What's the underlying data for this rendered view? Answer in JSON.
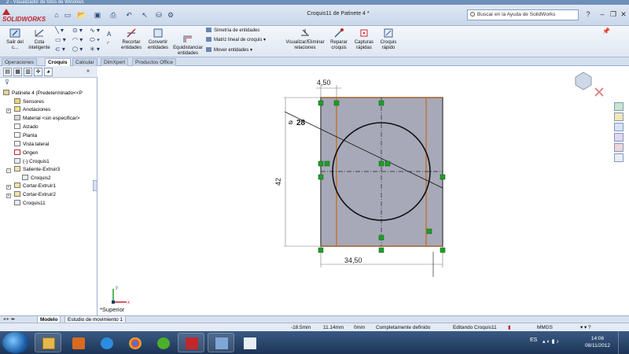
{
  "outer_window": {
    "title": "2 - Visualizador de fotos de Windows"
  },
  "titlebar": {
    "app_name": "SOLIDWORKS",
    "doc_title": "Croquis11 de Patinete 4 *",
    "help_search_placeholder": "Buscar en la Ayuda de SolidWorks"
  },
  "ribbon": {
    "exit_sketch": "Salir del c...",
    "smart_dim_1": "Cota",
    "smart_dim_2": "inteligente",
    "trim_1": "Recortar",
    "trim_2": "entidades",
    "convert_1": "Convertir",
    "convert_2": "entidades",
    "offset_1": "Equidistanciar",
    "offset_2": "entidades",
    "mirror": "Simetría de entidades",
    "linear_pattern": "Matriz lineal de croquis",
    "move": "Mover entidades",
    "display_rel_1": "Visualizar/Eliminar",
    "display_rel_2": "relaciones",
    "repair_1": "Reparar",
    "repair_2": "croquis",
    "quick_snaps_1": "Capturas",
    "quick_snaps_2": "rápidas",
    "rapid_sketch_1": "Croquis",
    "rapid_sketch_2": "rápido"
  },
  "command_tabs": [
    "Operaciones",
    "Croquis",
    "Calcular",
    "DimXpert",
    "Productos Office"
  ],
  "feature_tree": {
    "root": "Patinete 4  (Predeterminado<<P",
    "items": [
      "Sensores",
      "Anotaciones",
      "Material <sin especificar>",
      "Alzado",
      "Planta",
      "Vista lateral",
      "Origen",
      "(-) Croquis1",
      "Saliente-Extruir3",
      "Croquis2",
      "Cortar-Extruir1",
      "Cortar-Extruir2",
      "Croquis11"
    ]
  },
  "sketch": {
    "dim_top": "4,50",
    "dim_diameter": "28",
    "dim_side": "42",
    "dim_bottom": "34,50",
    "view_label": "*Superior",
    "axis_x": "x",
    "axis_y": "y"
  },
  "bottom_tabs": [
    "Modelo",
    "Estudio de movimiento 1"
  ],
  "status": {
    "x": "-18.5mm",
    "y": "11.14mm",
    "z": "0mm",
    "state": "Completamente definido",
    "editing": "Editando Croquis11",
    "units": "MMGS"
  },
  "taskbar": {
    "lang": "ES",
    "time": "14:06",
    "date": "08/11/2012"
  },
  "colors": {
    "accent": "#c1272d",
    "ribbon": "#dfe7f2",
    "sketch_gray": "#a7a9b8",
    "fixed_green": "#1f9e2a",
    "edge_orange": "#c46a18"
  }
}
